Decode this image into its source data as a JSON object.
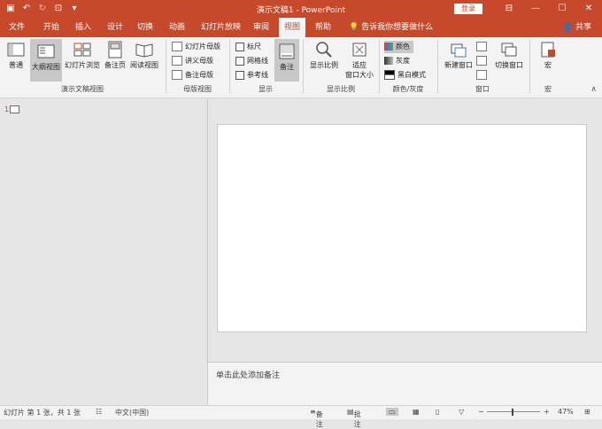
{
  "window": {
    "title": "演示文稿1 - PowerPoint",
    "login_label": "登录"
  },
  "accent_color": "#c5492a",
  "tabs": [
    {
      "label": "文件"
    },
    {
      "label": "开始"
    },
    {
      "label": "插入"
    },
    {
      "label": "设计"
    },
    {
      "label": "切换"
    },
    {
      "label": "动画"
    },
    {
      "label": "幻灯片放映"
    },
    {
      "label": "审阅"
    },
    {
      "label": "视图",
      "active": true
    },
    {
      "label": "帮助"
    }
  ],
  "tell_me": "告诉我你想要做什么",
  "share_label": "共享",
  "ribbon": {
    "presentation_views": {
      "group": "演示文稿视图",
      "normal": "普通",
      "outline": "大纲视图",
      "sorter": "幻灯片浏览",
      "notes_page": "备注页",
      "reading": "阅读视图"
    },
    "master_views": {
      "group": "母版视图",
      "slide_master": "幻灯片母版",
      "handout_master": "讲义母版",
      "notes_master": "备注母版"
    },
    "show": {
      "group": "显示",
      "ruler": "标尺",
      "gridlines": "网格线",
      "guides": "参考线",
      "notes": "备注"
    },
    "zoom": {
      "group": "显示比例",
      "zoom": "显示比例",
      "fit_line1": "适应",
      "fit_line2": "窗口大小"
    },
    "color": {
      "group": "颜色/灰度",
      "color": "颜色",
      "grayscale": "灰度",
      "bw": "黑白模式"
    },
    "window": {
      "group": "窗口",
      "new_window": "新建窗口",
      "switch_window": "切换窗口"
    },
    "macros": {
      "group": "宏",
      "macro": "宏"
    }
  },
  "slides": {
    "first_number": "1"
  },
  "notes_placeholder": "单击此处添加备注",
  "status": {
    "slide_info": "幻灯片 第 1 张，共 1 张",
    "language": "中文(中国)",
    "notes": "备注",
    "comments": "批注",
    "zoom": "47%"
  }
}
